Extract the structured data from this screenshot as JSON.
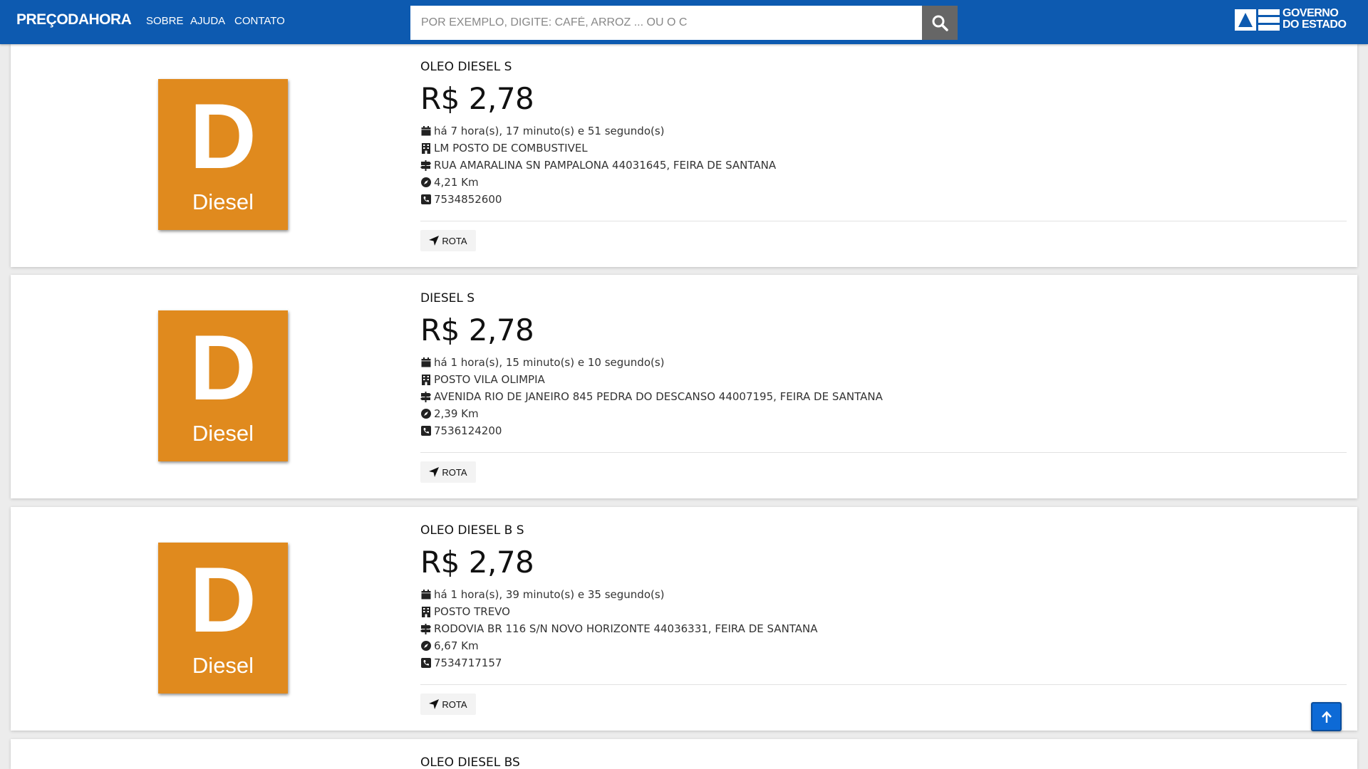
{
  "header": {
    "brand": "PREÇODAHORA",
    "nav": [
      "SOBRE",
      "AJUDA",
      "CONTATO"
    ],
    "search_placeholder": "POR EXEMPLO, DIGITE: CAFÉ, ARROZ ... OU O C",
    "gov_logo_line1": "GOVERNO",
    "gov_logo_line2": "DO ESTADO"
  },
  "thumbnail": {
    "letter": "D",
    "word": "Diesel",
    "color": "#e08a1e"
  },
  "cards": [
    {
      "name": "OLEO DIESEL S",
      "price": "R$ 2,78",
      "time": "há 7 hora(s), 17 minuto(s) e 51 segundo(s)",
      "station": "LM POSTO DE COMBUSTIVEL",
      "address": "RUA AMARALINA SN PAMPALONA 44031645, FEIRA DE SANTANA",
      "distance": "4,21 Km",
      "phone": "7534852600",
      "route_label": "ROTA"
    },
    {
      "name": "DIESEL S",
      "price": "R$ 2,78",
      "time": "há 1 hora(s), 15 minuto(s) e 10 segundo(s)",
      "station": "POSTO VILA OLIMPIA",
      "address": "AVENIDA RIO DE JANEIRO 845 PEDRA DO DESCANSO 44007195, FEIRA DE SANTANA",
      "distance": "2,39 Km",
      "phone": "7536124200",
      "route_label": "ROTA"
    },
    {
      "name": "OLEO DIESEL B S",
      "price": "R$ 2,78",
      "time": "há 1 hora(s), 39 minuto(s) e 35 segundo(s)",
      "station": "POSTO TREVO",
      "address": "RODOVIA BR 116 S/N NOVO HORIZONTE 44036331, FEIRA DE SANTANA",
      "distance": "6,67 Km",
      "phone": "7534717157",
      "route_label": "ROTA"
    },
    {
      "name": "OLEO DIESEL BS"
    }
  ],
  "icons": {
    "search": "search-icon",
    "calendar": "calendar-icon",
    "building": "building-icon",
    "signpost": "signpost-icon",
    "compass": "compass-icon",
    "phone": "phone-icon",
    "route": "location-arrow-icon",
    "scroll_top": "arrow-up-icon"
  },
  "colors": {
    "header": "#0d5ab0",
    "accent_button": "#0d6ad6",
    "search_button": "#666666"
  }
}
